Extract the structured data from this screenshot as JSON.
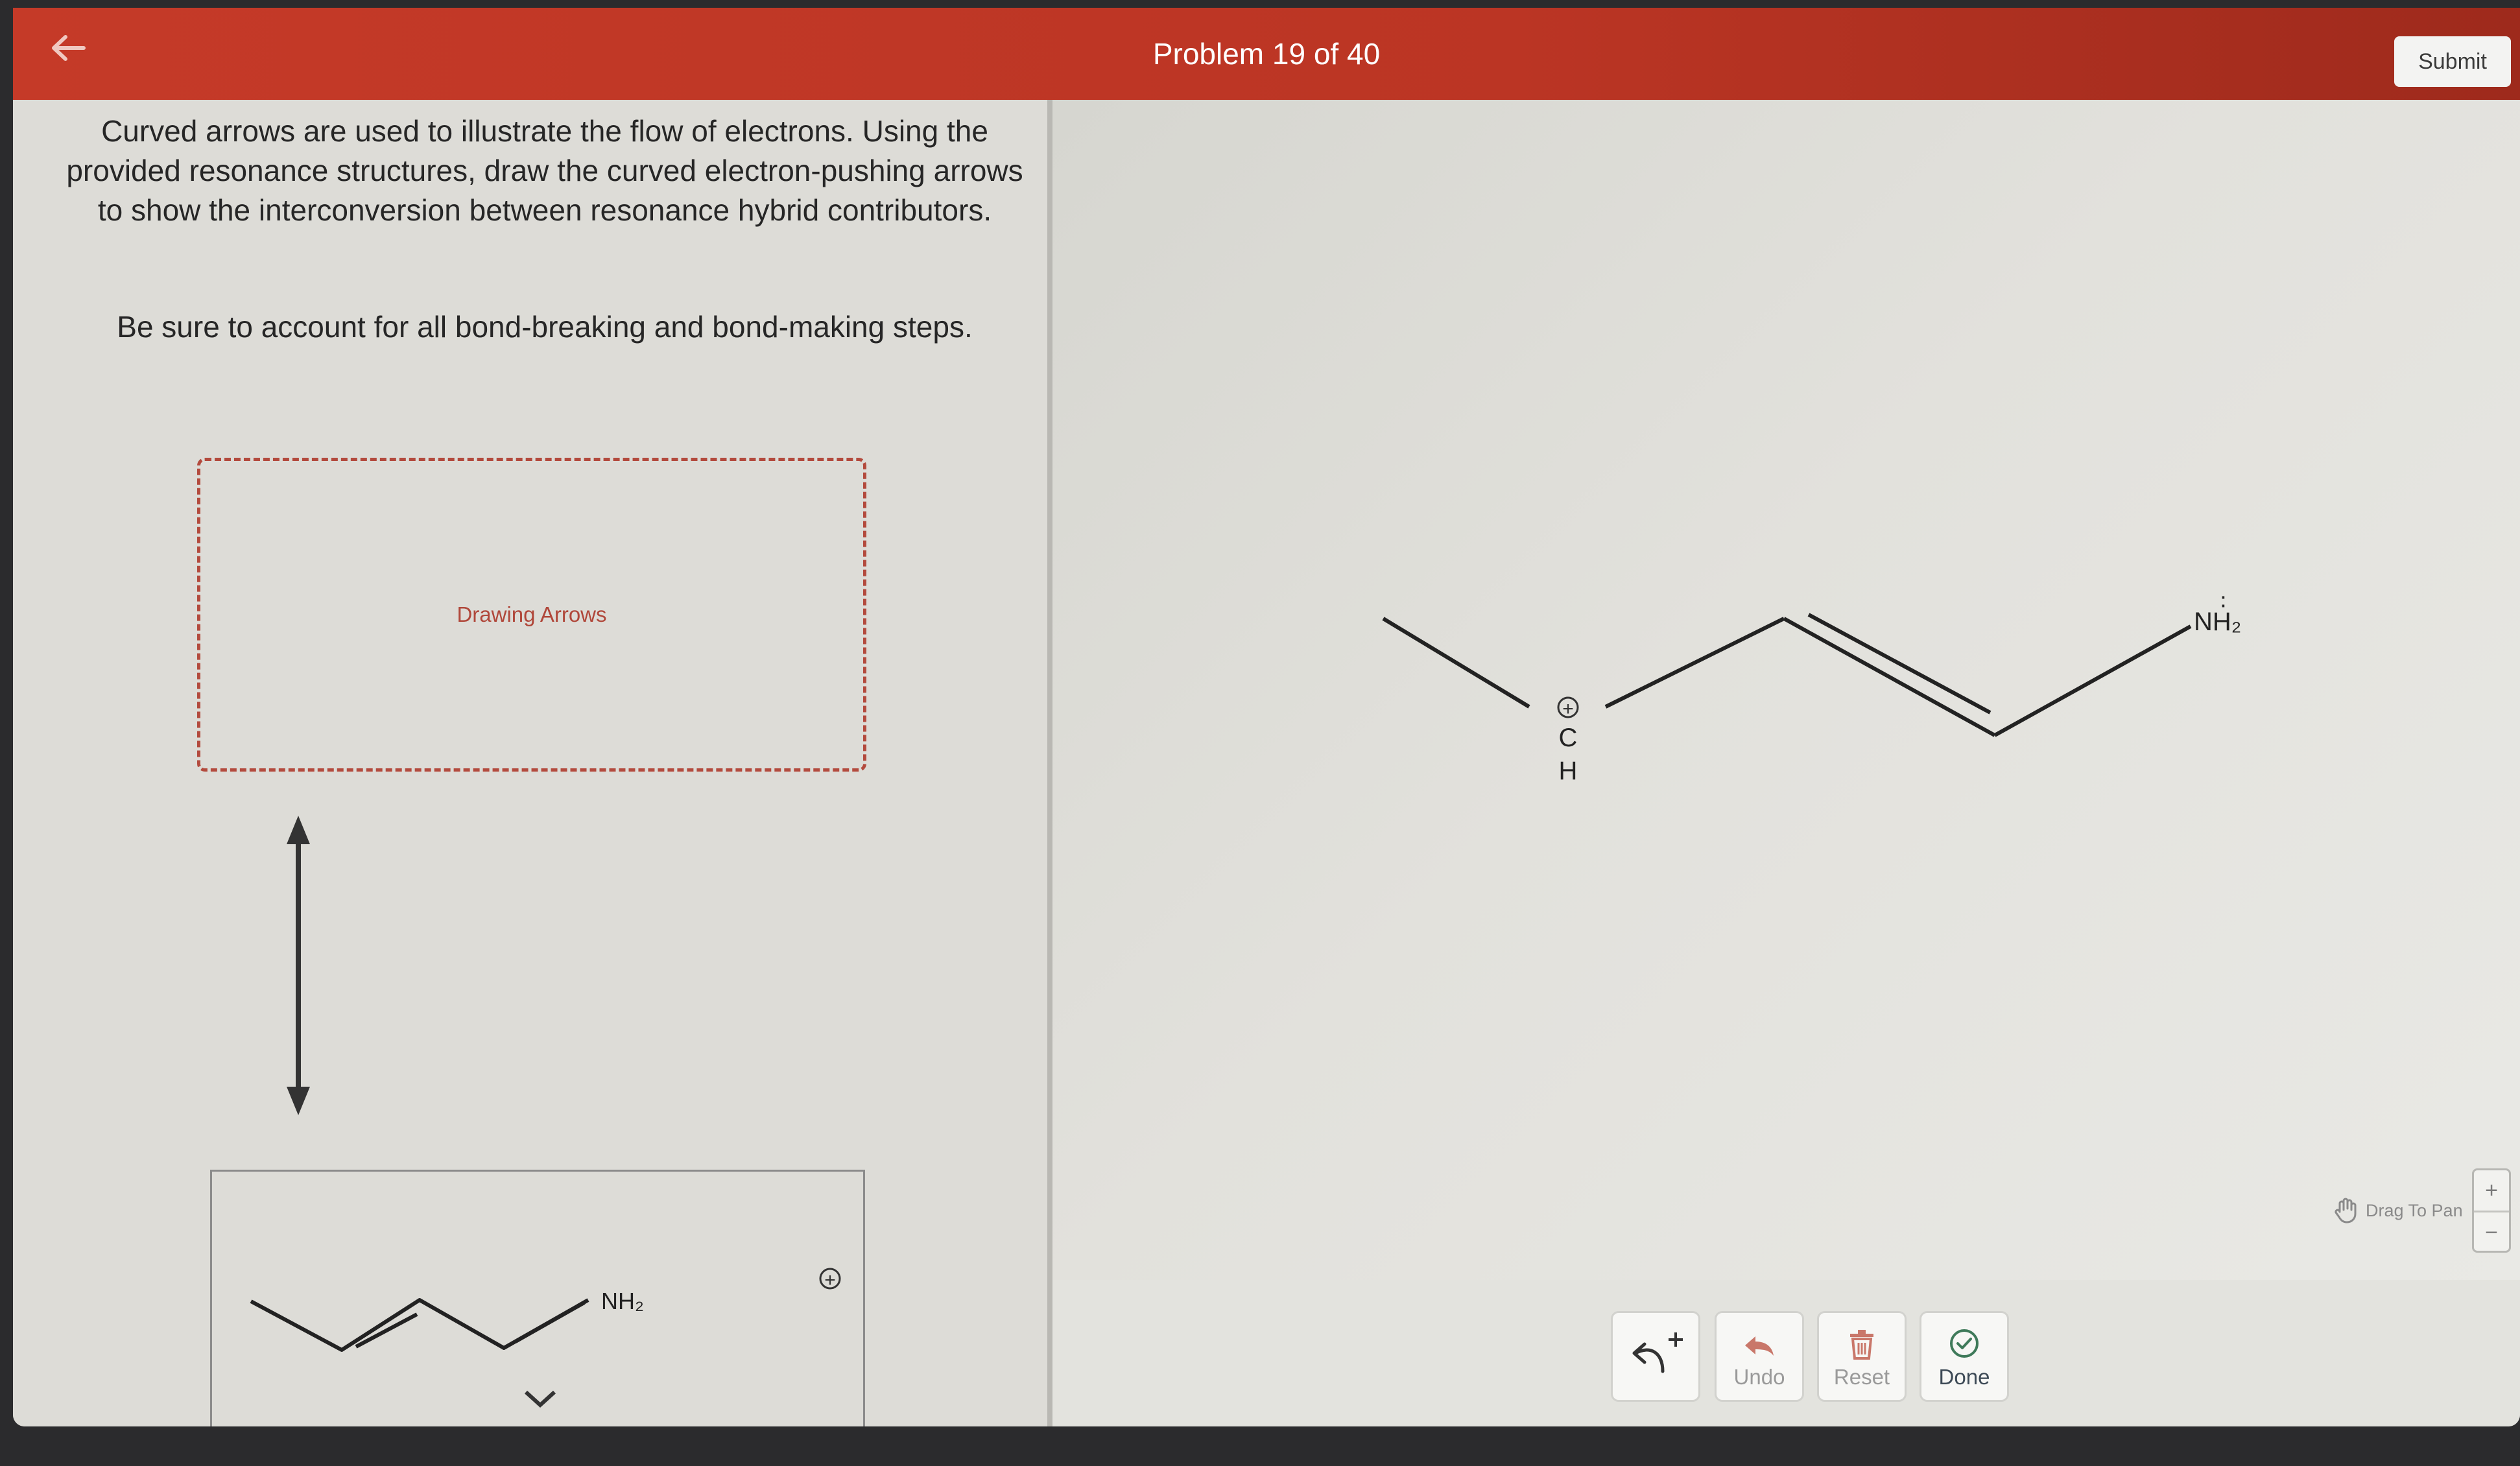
{
  "header": {
    "title": "Problem 19 of 40",
    "submit_label": "Submit",
    "accent_color": "#c53a28"
  },
  "instructions": {
    "paragraph1": "Curved arrows are used to illustrate the flow of electrons. Using the provided resonance structures, draw the curved electron-pushing arrows to show the interconversion between resonance hybrid contributors.",
    "paragraph2": "Be sure to account for all bond-breaking and bond-making steps."
  },
  "drawing_area": {
    "label": "Drawing Arrows"
  },
  "left_molecule": {
    "group_label": "NH₂",
    "charge": "+"
  },
  "canvas_molecule": {
    "carbon_label": "C",
    "hydrogen_label": "H",
    "charge": "+",
    "group_label": "NH₂",
    "lone_pair": "∶"
  },
  "canvas_controls": {
    "pan_label": "Drag To Pan",
    "zoom_in": "+",
    "zoom_out": "−"
  },
  "toolbar": {
    "arrow_tool_icon": "curved-arrow-plus-icon",
    "undo_label": "Undo",
    "reset_label": "Reset",
    "done_label": "Done"
  }
}
